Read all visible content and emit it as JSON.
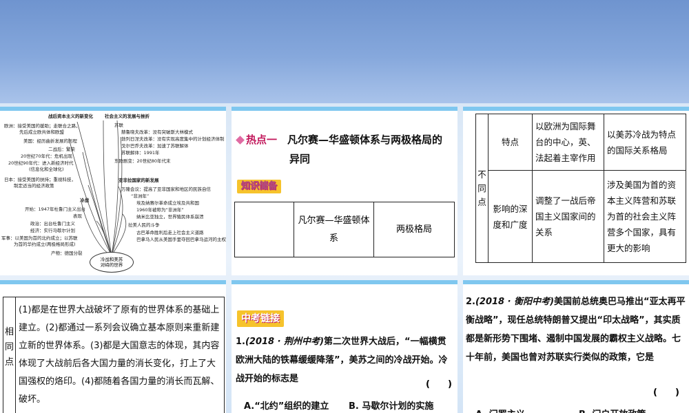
{
  "colors": {
    "accent": "#7fc7ef",
    "badge": "#f6c32c",
    "hot_tag": "#c2185b"
  },
  "mindmap": {
    "center": [
      "冷战和美苏",
      "对峙的世界"
    ],
    "left_title": "战后资本主义的新变化",
    "left_items": [
      "欧洲：接受美国的援助；走联合之路，",
      "先后成立欧共体和欧盟",
      "美国：经历曲折发展的历程",
      "二战后：繁荣",
      "20世纪70年代：危机出现",
      "20世纪90年代：进入新经济时代",
      "(信息化和全球化)",
      "日本：接受美国的扶持；重视科技，",
      "制定适当的经济政策"
    ],
    "cold_title": "冷战",
    "cold_items": [
      "开始：1947年杜鲁门主义出台",
      "表现",
      "政治：出台杜鲁门主义",
      "经济：实行马歇尔计划",
      "军事：以美国为首的北约成立；以苏联",
      "为首的华约成立(两极格局形成)",
      "产物：德国分裂"
    ],
    "soc_title": "社会主义的发展与挫折",
    "soc_items": [
      "苏联",
      "赫鲁晓夫改革：没有突破斯大林模式",
      "勃列日涅夫改革：没有实现高度集中的计划经济体制",
      "戈尔巴乔夫改革：加速了苏联解体",
      "苏联解体：1991年",
      "东欧剧变：20世纪80年代末"
    ],
    "asia_title": "亚非拉国家的新发展",
    "asia_items": [
      "万隆会议：提高了亚非国家和地区的民族自信",
      "“非洲年”",
      "埃及纳赛尔革命成立埃及共和国",
      "1960年被称为“非洲年”",
      "纳米比亚独立，世界殖民体系崩溃",
      "拉美人民的斗争",
      "古巴革命胜利后走上社会主义道路",
      "巴拿马人民从美国手里夺回巴拿马运河的主权"
    ]
  },
  "hot_point": {
    "tag": "热点一",
    "title_line1": "凡尔赛—华盛顿体系与两极格局的",
    "title_line2": "异同",
    "badge": "知识储备",
    "col1": "",
    "col2": "凡尔赛—华盛顿体系",
    "col3": "两极格局"
  },
  "comparison": {
    "group_label": "不同点",
    "rows": [
      {
        "label": "特点",
        "a": "以欧洲为国际舞台的中心，英、法起着主宰作用",
        "b": "以美苏冷战为特点的国际关系格局"
      },
      {
        "label": "影响的深度和广度",
        "a": "调整了一战后帝国主义国家间的关系",
        "b": "涉及美国为首的资本主义阵营和苏联为首的社会主义阵营多个国家，具有更大的影响"
      }
    ]
  },
  "similarity": {
    "label": "相同点",
    "text": "(1)都是在世界大战破坏了原有的世界体系的基础上建立。(2)都通过一系列会议确立基本原则来重新建立新的世界体系。(3)都是大国意志的体现，其内容体现了大战前后各大国力量的消长变化，打上了大国强权的烙印。(4)都随着各国力量的消长而瓦解、破坏。"
  },
  "exam_link": {
    "badge": "中考链接",
    "q1_num": "1.",
    "q1_src": "(2018 · 荆州中考)",
    "q1_text": "第二次世界大战后，“一幅横贯欧洲大陆的铁幕缓缓降落”，美苏之间的冷战开始。冷战开始的标志是",
    "q1_bracket": "(　　)",
    "q1_optA": "A.“北约”组织的建立",
    "q1_optB": "B. 马歇尔计划的实施"
  },
  "q2": {
    "num": "2.",
    "src": "(2018 · 衡阳中考)",
    "text": "美国前总统奥巴马推出“亚太再平衡战略”，现任总统特朗普又提出“印太战略”，其实质都是新形势下围堵、遏制中国发展的霸权主义战略。七十年前，美国也曾对苏联实行类似的政策，它是",
    "bracket": "(　　)",
    "optA": "A. 门罗主义",
    "optB": "B. 门户开放政策"
  }
}
